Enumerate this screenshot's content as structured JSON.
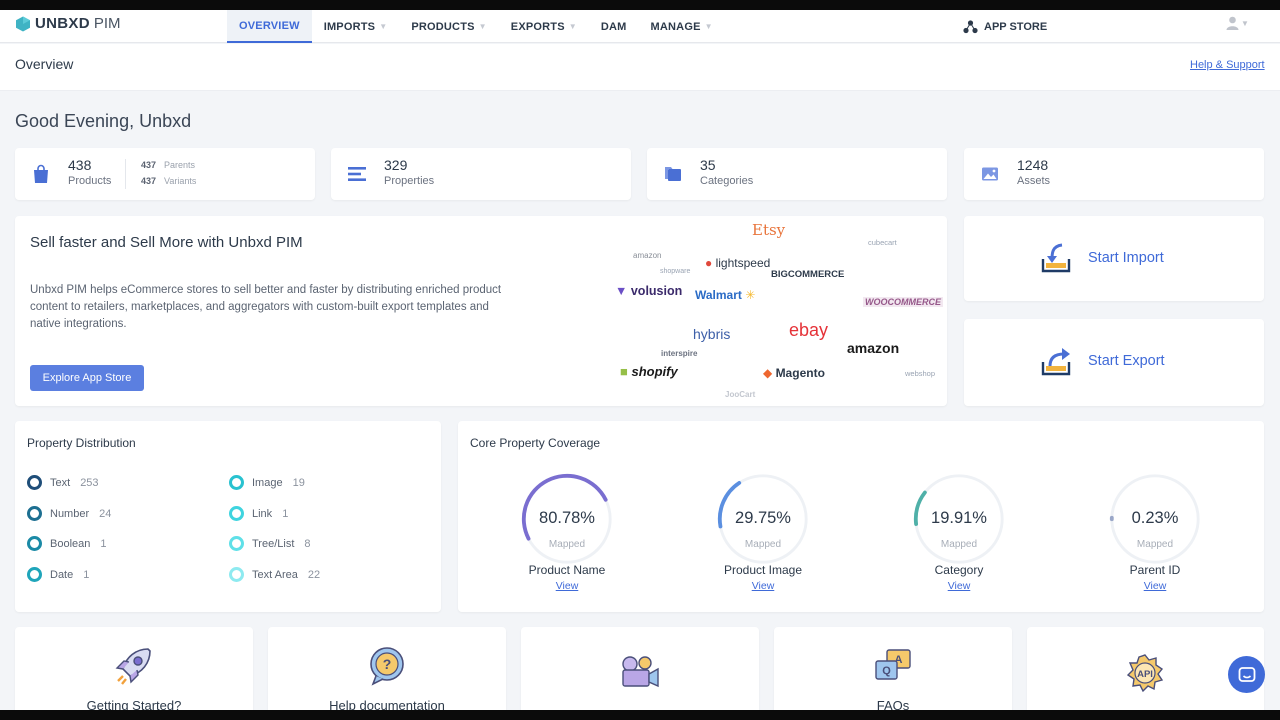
{
  "brand": {
    "name": "UNBXD",
    "suffix": "PIM"
  },
  "nav": {
    "items": [
      {
        "label": "OVERVIEW",
        "active": true,
        "caret": false
      },
      {
        "label": "IMPORTS",
        "caret": true
      },
      {
        "label": "PRODUCTS",
        "caret": true
      },
      {
        "label": "EXPORTS",
        "caret": true
      },
      {
        "label": "DAM",
        "caret": false
      },
      {
        "label": "MANAGE",
        "caret": true
      }
    ],
    "app_store": "APP STORE"
  },
  "subheader": {
    "title": "Overview",
    "help_link": "Help & Support"
  },
  "greeting": "Good Evening, Unbxd",
  "stats": {
    "products": {
      "value": "438",
      "label": "Products",
      "parents_value": "437",
      "parents_label": "Parents",
      "variants_value": "437",
      "variants_label": "Variants"
    },
    "properties": {
      "value": "329",
      "label": "Properties"
    },
    "categories": {
      "value": "35",
      "label": "Categories"
    },
    "assets": {
      "value": "1248",
      "label": "Assets"
    }
  },
  "promo": {
    "heading": "Sell faster and Sell More with Unbxd PIM",
    "body": "Unbxd PIM helps eCommerce stores to sell better and faster by distributing enriched product content to retailers, marketplaces, and aggregators with custom-built export templates and native integrations.",
    "button": "Explore App Store",
    "logos": [
      "Etsy",
      "lightspeed",
      "BIGCOMMERCE",
      "volusion",
      "Walmart",
      "WOOCOMMERCE",
      "hybris",
      "ebay",
      "amazon",
      "shopify",
      "Magento",
      "amazon",
      "shopware",
      "interspire",
      "cubecart",
      "webshop",
      "JooCart"
    ]
  },
  "actions": {
    "import": "Start Import",
    "export": "Start Export"
  },
  "property_distribution": {
    "title": "Property Distribution",
    "items": [
      {
        "label": "Text",
        "count": "253",
        "color": "#1f4e79"
      },
      {
        "label": "Number",
        "count": "24",
        "color": "#1d6f91"
      },
      {
        "label": "Boolean",
        "count": "1",
        "color": "#1b8aa6"
      },
      {
        "label": "Date",
        "count": "1",
        "color": "#1fa5ba"
      },
      {
        "label": "Image",
        "count": "19",
        "color": "#29c2d0"
      },
      {
        "label": "Link",
        "count": "1",
        "color": "#3fd4df"
      },
      {
        "label": "Tree/List",
        "count": "8",
        "color": "#5fe0e8"
      },
      {
        "label": "Text Area",
        "count": "22",
        "color": "#8eeaf0"
      }
    ]
  },
  "coverage": {
    "title": "Core Property Coverage",
    "mapped_label": "Mapped",
    "view_label": "View",
    "items": [
      {
        "name": "Product Name",
        "percent_text": "80.78%",
        "fraction": 0.8078,
        "color": "#7a6ed0"
      },
      {
        "name": "Product Image",
        "percent_text": "29.75%",
        "fraction": 0.2975,
        "color": "#5b8fe0"
      },
      {
        "name": "Category",
        "percent_text": "19.91%",
        "fraction": 0.1991,
        "color": "#4fb0a8"
      },
      {
        "name": "Parent ID",
        "percent_text": "0.23%",
        "fraction": 0.0023,
        "color": "#9aa7c8"
      }
    ]
  },
  "tiles": [
    {
      "label": "Getting Started?",
      "icon": "rocket-icon"
    },
    {
      "label": "Help documentation",
      "icon": "help-bubble-icon"
    },
    {
      "label": "",
      "icon": "video-camera-icon"
    },
    {
      "label": "FAQs",
      "icon": "faq-icon"
    },
    {
      "label": "",
      "icon": "api-gear-icon"
    }
  ],
  "colors": {
    "accent": "#3f6ad8",
    "button": "#5b7fe0",
    "icon_blue": "#4a6fd4"
  }
}
